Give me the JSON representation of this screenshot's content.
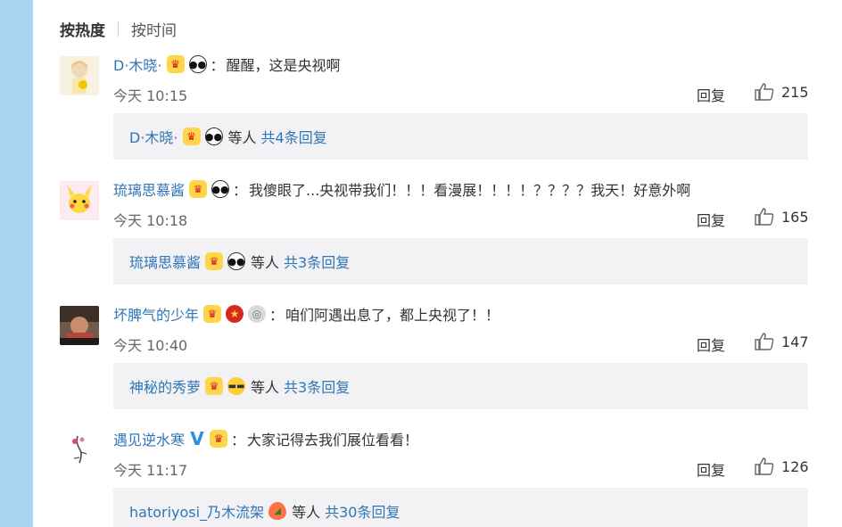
{
  "sort": {
    "active": "按热度",
    "inactive": "按时间"
  },
  "comments": [
    {
      "user": "D·木晓·",
      "badges": [
        "vip",
        "panda"
      ],
      "text": "醒醒，这是央视啊",
      "time": "今天 10:15",
      "reply_label": "回复",
      "likes": "215",
      "sub": {
        "user": "D·木晓·",
        "badges": [
          "vip",
          "panda"
        ],
        "etc": "等人",
        "more": "共4条回复"
      }
    },
    {
      "user": "琉璃思慕酱",
      "badges": [
        "vip",
        "panda"
      ],
      "text": "我傻眼了...央视带我们！！！看漫展！！！！？？？？我天！好意外啊",
      "time": "今天 10:18",
      "reply_label": "回复",
      "likes": "165",
      "sub": {
        "user": "琉璃思慕酱",
        "badges": [
          "vip",
          "panda"
        ],
        "etc": "等人",
        "more": "共3条回复"
      }
    },
    {
      "user": "坏脾气的少年",
      "badges": [
        "vip",
        "star",
        "medal"
      ],
      "text": "咱们阿遇出息了，都上央视了！！",
      "time": "今天 10:40",
      "reply_label": "回复",
      "likes": "147",
      "sub": {
        "user": "神秘的秀萝",
        "badges": [
          "vip",
          "cool"
        ],
        "etc": "等人",
        "more": "共3条回复"
      }
    },
    {
      "user": "遇见逆水寒",
      "badges": [
        "verified",
        "vip"
      ],
      "text": "大家记得去我们展位看看！",
      "time": "今天 11:17",
      "reply_label": "回复",
      "likes": "126",
      "sub": {
        "user": "hatoriyosi_乃木流架",
        "badges": [
          "melon"
        ],
        "etc": "等人",
        "more": "共30条回复"
      }
    }
  ],
  "colon": "："
}
